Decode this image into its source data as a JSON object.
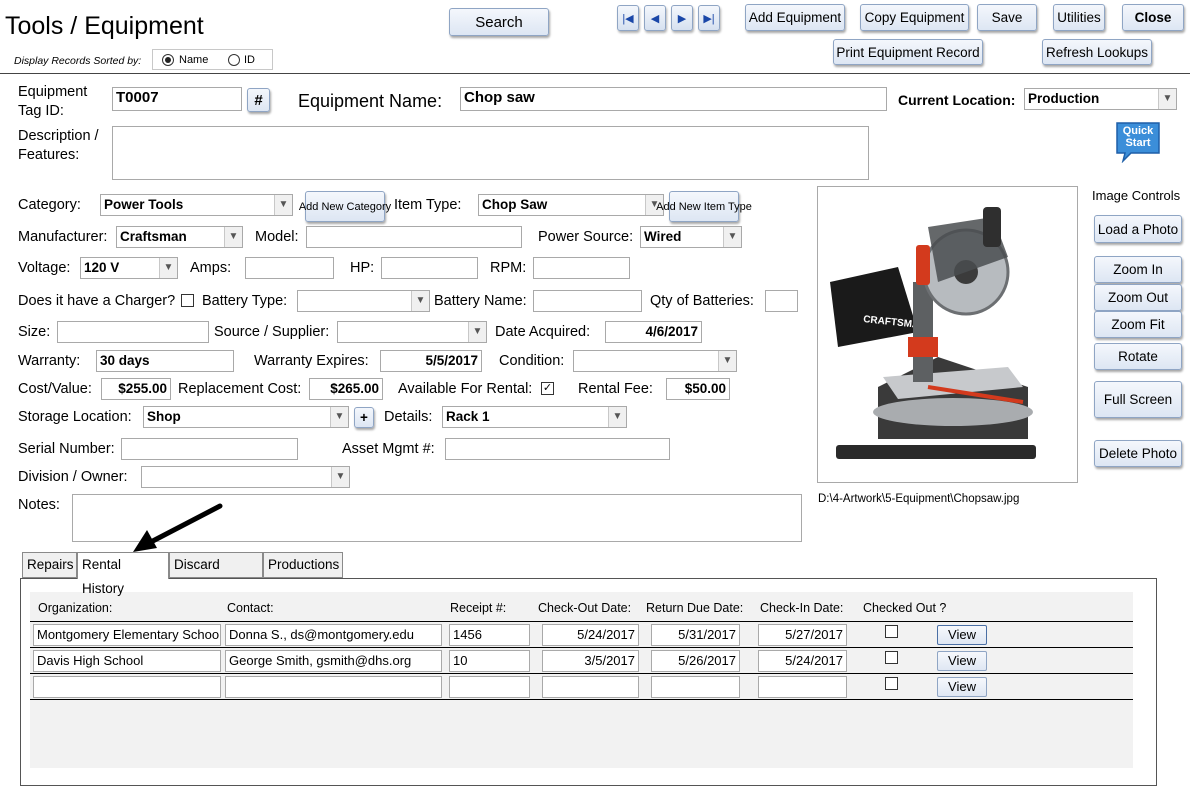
{
  "title": "Tools / Equipment",
  "sort": {
    "label": "Display Records Sorted by:",
    "option_name": "Name",
    "option_id": "ID",
    "selected": "Name"
  },
  "toolbar": {
    "search": "Search",
    "add_equipment": "Add Equipment",
    "copy_equipment": "Copy Equipment",
    "save": "Save",
    "utilities": "Utilities",
    "close": "Close",
    "print_record": "Print Equipment Record",
    "refresh_lookups": "Refresh Lookups",
    "quick_start": "Quick Start"
  },
  "form": {
    "tag_id_label": "Equipment Tag ID:",
    "tag_id": "T0007",
    "hash_button": "#",
    "name_label": "Equipment Name:",
    "name": "Chop saw",
    "location_label": "Current Location:",
    "location": "Production",
    "description_label": "Description / Features:",
    "description": "",
    "category_label": "Category:",
    "category": "Power Tools",
    "add_category": "Add New Category",
    "item_type_label": "Item Type:",
    "item_type": "Chop Saw",
    "add_item_type": "Add New Item Type",
    "manufacturer_label": "Manufacturer:",
    "manufacturer": "Craftsman",
    "model_label": "Model:",
    "model": "",
    "power_source_label": "Power Source:",
    "power_source": "Wired",
    "voltage_label": "Voltage:",
    "voltage": "120 V",
    "amps_label": "Amps:",
    "hp_label": "HP:",
    "rpm_label": "RPM:",
    "charger_label": "Does it have a Charger?",
    "battery_type_label": "Battery Type:",
    "battery_name_label": "Battery Name:",
    "qty_batteries_label": "Qty of Batteries:",
    "size_label": "Size:",
    "supplier_label": "Source / Supplier:",
    "date_acquired_label": "Date Acquired:",
    "date_acquired": "4/6/2017",
    "warranty_label": "Warranty:",
    "warranty": "30 days",
    "warranty_expires_label": "Warranty Expires:",
    "warranty_expires": "5/5/2017",
    "condition_label": "Condition:",
    "cost_label": "Cost/Value:",
    "cost": "$255.00",
    "replacement_label": "Replacement Cost:",
    "replacement": "$265.00",
    "available_label": "Available For Rental:",
    "available": true,
    "rental_fee_label": "Rental Fee:",
    "rental_fee": "$50.00",
    "storage_label": "Storage Location:",
    "storage": "Shop",
    "plus_button": "+",
    "details_label": "Details:",
    "details": "Rack 1",
    "serial_label": "Serial Number:",
    "asset_label": "Asset Mgmt #:",
    "division_label": "Division / Owner:",
    "notes_label": "Notes:"
  },
  "image": {
    "controls_label": "Image Controls",
    "load": "Load a Photo",
    "zoom_in": "Zoom In",
    "zoom_out": "Zoom Out",
    "zoom_fit": "Zoom Fit",
    "rotate": "Rotate",
    "full_screen": "Full Screen",
    "delete": "Delete Photo",
    "path": "D:\\4-Artwork\\5-Equipment\\Chopsaw.jpg",
    "brand_text": "CRAFTSMAN"
  },
  "tabs": [
    "Repairs",
    "Rental History",
    "Discard Notes",
    "Productions"
  ],
  "active_tab": "Rental History",
  "rental": {
    "headers": [
      "Organization:",
      "Contact:",
      "Receipt #:",
      "Check-Out Date:",
      "Return Due Date:",
      "Check-In Date:",
      "Checked Out ?"
    ],
    "view_label": "View",
    "rows": [
      {
        "org": "Montgomery Elementary School",
        "contact": "Donna S., ds@montgomery.edu",
        "receipt": "1456",
        "checkout": "5/24/2017",
        "due": "5/31/2017",
        "checkin": "5/27/2017",
        "checked_out": false
      },
      {
        "org": "Davis High School",
        "contact": "George Smith, gsmith@dhs.org",
        "receipt": "10",
        "checkout": "3/5/2017",
        "due": "5/26/2017",
        "checkin": "5/24/2017",
        "checked_out": false
      },
      {
        "org": "",
        "contact": "",
        "receipt": "",
        "checkout": "",
        "due": "",
        "checkin": "",
        "checked_out": false
      }
    ]
  },
  "colors": {
    "button_border": "#8fa5c4",
    "nav_arrow": "#1a47a8",
    "quick_start": "#3b8ed9"
  }
}
